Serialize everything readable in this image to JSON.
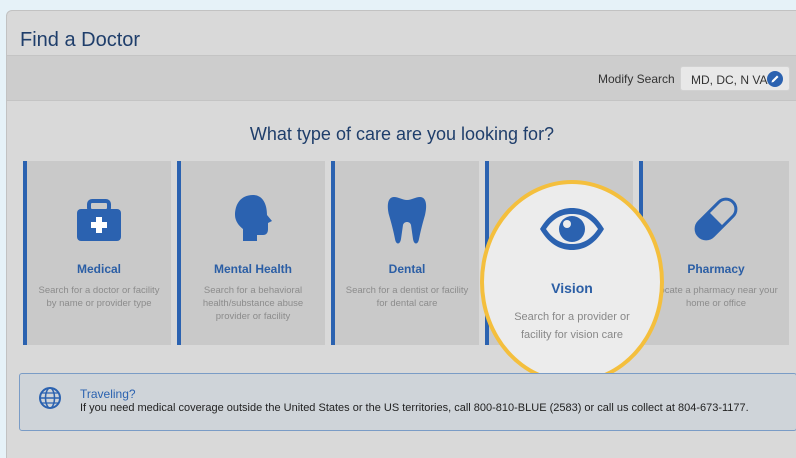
{
  "page": {
    "title": "Find a Doctor"
  },
  "modify": {
    "label": "Modify Search",
    "location": "MD, DC, N VA"
  },
  "care": {
    "heading": "What type of care are you looking for?",
    "cards": [
      {
        "title": "Medical",
        "desc": "Search for a doctor or facility by name or provider type",
        "icon": "medical-kit-icon"
      },
      {
        "title": "Mental Health",
        "desc": "Search for a behavioral health/substance abuse provider or facility",
        "icon": "head-silhouette-icon"
      },
      {
        "title": "Dental",
        "desc": "Search for a dentist or facility for dental care",
        "icon": "tooth-icon"
      },
      {
        "title": "Vision",
        "desc": "Search for a provider or facility for vision care",
        "icon": "eye-icon"
      },
      {
        "title": "Pharmacy",
        "desc": "Locate a pharmacy near your home or office",
        "icon": "pill-capsule-icon"
      }
    ]
  },
  "travel": {
    "title": "Traveling?",
    "text": "If you need medical coverage outside the United States or the US territories, call 800-810-BLUE (2583) or call us collect at 804-673-1177."
  },
  "colors": {
    "accent": "#2b62b0",
    "highlight_ring": "#f4bf3d",
    "title_text": "#1f3e6b"
  }
}
